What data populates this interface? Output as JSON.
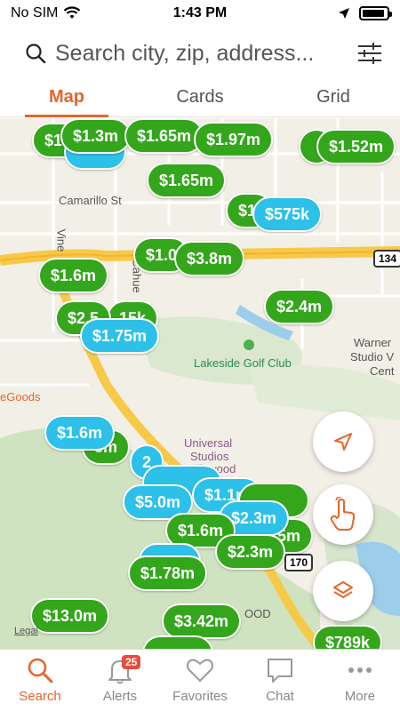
{
  "status_bar": {
    "carrier": "No SIM",
    "time": "1:43 PM"
  },
  "search": {
    "placeholder": "Search city, zip, address..."
  },
  "tabs": [
    {
      "label": "Map",
      "active": true
    },
    {
      "label": "Cards",
      "active": false
    },
    {
      "label": "Grid",
      "active": false
    }
  ],
  "map": {
    "labels": {
      "camarillo": "Camarillo St",
      "vine": "Vine",
      "cahuenga": "Cahue",
      "golf": "Lakeside Golf Club",
      "warner": "Warner",
      "studio_v": "Studio V",
      "cent": "Cent",
      "egoods": "eGoods",
      "universal1": "Universal",
      "universal2": "Studios",
      "hollywood": "llywood",
      "ood": "OOD"
    },
    "highways": {
      "h134": "134",
      "h170": "170"
    },
    "legal": "Legal",
    "pins": [
      {
        "price": "$1.3m",
        "color": "green"
      },
      {
        "price": "$1.6",
        "color": "green"
      },
      {
        "price": "$1.65m",
        "color": "green"
      },
      {
        "price": "$1.97m",
        "color": "green"
      },
      {
        "price": "$1.52m",
        "color": "green"
      },
      {
        "price": "$1.65m",
        "color": "green"
      },
      {
        "price": "$1.",
        "color": "green"
      },
      {
        "price": "$575k",
        "color": "blue"
      },
      {
        "price": "$1.0",
        "color": "green"
      },
      {
        "price": "$3.8m",
        "color": "green"
      },
      {
        "price": "$1.6m",
        "color": "green"
      },
      {
        "price": "$2.4m",
        "color": "green"
      },
      {
        "price": "$2.5",
        "color": "green"
      },
      {
        "price": "15k",
        "color": "green"
      },
      {
        "price": "$1.75m",
        "color": "blue"
      },
      {
        "price": "$1.6m",
        "color": "blue"
      },
      {
        "price": "5m",
        "color": "green"
      },
      {
        "price": "2",
        "color": "blue"
      },
      {
        "price": "$5.0m",
        "color": "blue"
      },
      {
        "price": "$1.1m",
        "color": "blue"
      },
      {
        "price": "$2.3m",
        "color": "blue"
      },
      {
        "price": "$1.6m",
        "color": "green"
      },
      {
        "price": "$2.3m",
        "color": "green"
      },
      {
        "price": "5m",
        "color": "green"
      },
      {
        "price": "$1.78m",
        "color": "green"
      },
      {
        "price": "$13.0m",
        "color": "green"
      },
      {
        "price": "$3.42m",
        "color": "green"
      },
      {
        "price": "$789k",
        "color": "green"
      }
    ]
  },
  "colors": {
    "accent": "#e8642a",
    "pin_green": "#34a61b",
    "pin_blue": "#2dc0e8",
    "badge": "#e74c3c"
  },
  "bottom_nav": [
    {
      "label": "Search",
      "icon": "search-icon",
      "active": true
    },
    {
      "label": "Alerts",
      "icon": "bell-icon",
      "badge": "25"
    },
    {
      "label": "Favorites",
      "icon": "heart-icon"
    },
    {
      "label": "Chat",
      "icon": "chat-icon"
    },
    {
      "label": "More",
      "icon": "more-icon"
    }
  ]
}
